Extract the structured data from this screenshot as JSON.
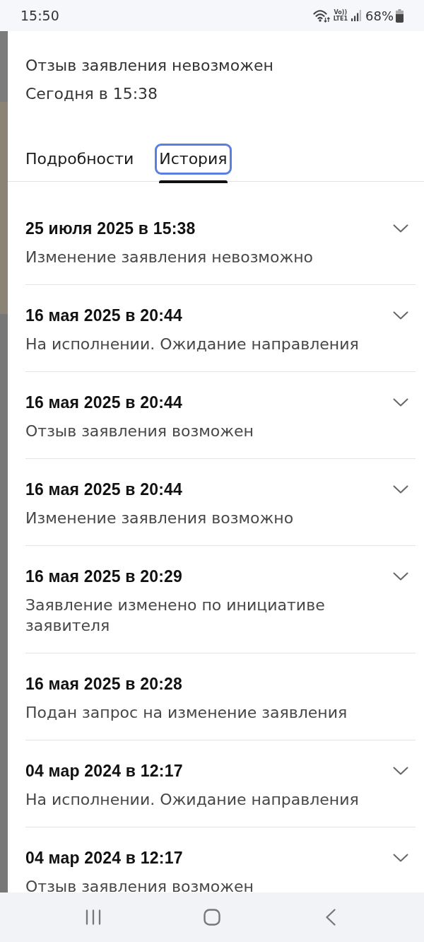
{
  "status_bar": {
    "time": "15:50",
    "volte": "Vo))",
    "network": "LTE1",
    "battery": "68%"
  },
  "header": {
    "title": "Отзыв заявления невозможен",
    "subtitle": "Сегодня в 15:38"
  },
  "tabs": [
    {
      "label": "Подробности",
      "selected": false,
      "focused": false
    },
    {
      "label": "История",
      "selected": true,
      "focused": true
    }
  ],
  "history": [
    {
      "date": "25 июля 2025 в 15:38",
      "status": "Изменение заявления невозможно",
      "expandable": true
    },
    {
      "date": "16 мая 2025 в 20:44",
      "status": "На исполнении. Ожидание направления",
      "expandable": true
    },
    {
      "date": "16 мая 2025 в 20:44",
      "status": "Отзыв заявления возможен",
      "expandable": true
    },
    {
      "date": "16 мая 2025 в 20:44",
      "status": "Изменение заявления возможно",
      "expandable": true
    },
    {
      "date": "16 мая 2025 в 20:29",
      "status": "Заявление изменено по инициативе заявителя",
      "expandable": true
    },
    {
      "date": "16 мая 2025 в 20:28",
      "status": "Подан запрос на изменение заявления",
      "expandable": false
    },
    {
      "date": "04 мар 2024 в 12:17",
      "status": "На исполнении. Ожидание направления",
      "expandable": true
    },
    {
      "date": "04 мар 2024 в 12:17",
      "status": "Отзыв заявления возможен",
      "expandable": true
    }
  ]
}
